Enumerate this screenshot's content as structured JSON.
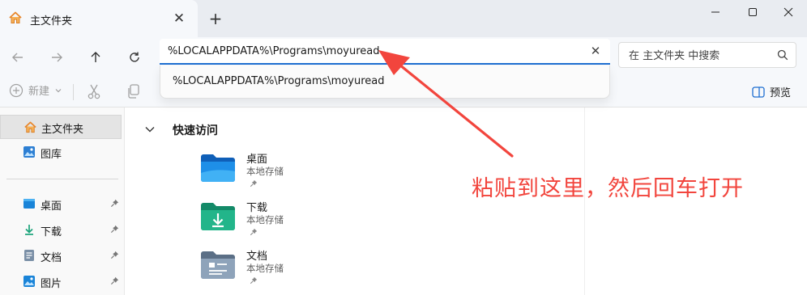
{
  "tab": {
    "title": "主文件夹",
    "icon": "home-icon"
  },
  "window": {
    "new_tab_label": "+"
  },
  "address_bar": {
    "value": "%LOCALAPPDATA%\\Programs\\moyuread",
    "clear_label": "✕",
    "suggestion": "%LOCALAPPDATA%\\Programs\\moyuread"
  },
  "search": {
    "placeholder": "在 主文件夹 中搜索"
  },
  "command_bar": {
    "new_label": "新建",
    "preview_label": "预览"
  },
  "sidebar": {
    "items": [
      {
        "label": "主文件夹",
        "icon": "home-icon",
        "selected": true,
        "pinned": false
      },
      {
        "label": "图库",
        "icon": "gallery-icon",
        "pinned": false
      },
      {
        "label": "桌面",
        "icon": "desktop-icon",
        "pinned": true
      },
      {
        "label": "下载",
        "icon": "download-icon",
        "pinned": true
      },
      {
        "label": "文档",
        "icon": "document-icon",
        "pinned": true
      },
      {
        "label": "图片",
        "icon": "picture-icon",
        "pinned": true
      }
    ]
  },
  "main": {
    "group_title": "快速访问",
    "items": [
      {
        "name": "桌面",
        "location": "本地存储",
        "icon": "desktop-folder-icon"
      },
      {
        "name": "下载",
        "location": "本地存储",
        "icon": "download-folder-icon"
      },
      {
        "name": "文档",
        "location": "本地存储",
        "icon": "document-folder-icon"
      }
    ]
  },
  "annotation": {
    "text": "粘贴到这里，然后回车打开",
    "color": "#f2453d"
  },
  "colors": {
    "accent": "#1f6fd1",
    "annotation": "#f2453d"
  }
}
